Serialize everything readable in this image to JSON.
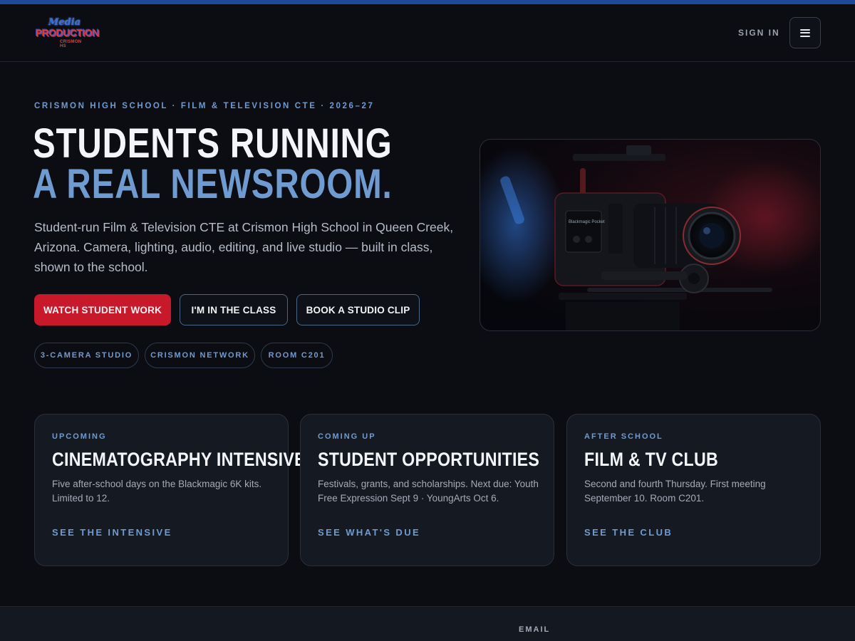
{
  "header": {
    "logo": {
      "line1": "Media",
      "line2": "PRODUCTION",
      "line3": "CRISMON HS"
    },
    "sign_in": "SIGN IN",
    "menu_icon": "hamburger-menu-icon"
  },
  "hero": {
    "eyebrow": "CRISMON HIGH SCHOOL · FILM & TELEVISION CTE · 2026–27",
    "title_line1": "STUDENTS RUNNING",
    "title_line2": "A REAL NEWSROOM.",
    "lead": "Student-run Film & Television CTE at Crismon High School in Queen Creek, Arizona. Camera, lighting, audio, editing, and live studio — built in class, shown to the school.",
    "buttons": {
      "primary": "WATCH STUDENT WORK",
      "secondary": "I'M IN THE CLASS",
      "tertiary": "BOOK A STUDIO CLIP"
    },
    "chips": [
      "3-CAMERA STUDIO",
      "CRISMON NETWORK",
      "ROOM C201"
    ],
    "image": {
      "camera_brand": "Blackmagic Pocket"
    }
  },
  "cards": [
    {
      "tag": "UPCOMING",
      "title": "CINEMATOGRAPHY INTENSIVE",
      "description": "Five after-school days on the Blackmagic 6K kits. Limited to 12.",
      "link": "SEE THE INTENSIVE"
    },
    {
      "tag": "COMING UP",
      "title": "STUDENT OPPORTUNITIES",
      "description": "Festivals, grants, and scholarships. Next due: Youth Free Expression Sept 9 · YoungArts Oct 6.",
      "link": "SEE WHAT'S DUE"
    },
    {
      "tag": "AFTER SCHOOL",
      "title": "FILM & TV CLUB",
      "description": "Second and fourth Thursday. First meeting September 10. Room C201.",
      "link": "SEE THE CLUB"
    }
  ],
  "footer": {
    "email_label": "EMAIL"
  },
  "colors": {
    "background": "#0b0d12",
    "accent_blue": "#6f9bd1",
    "accent_red": "#c8192a",
    "top_bar": "#1f4a9c",
    "card_bg": "#151922"
  }
}
